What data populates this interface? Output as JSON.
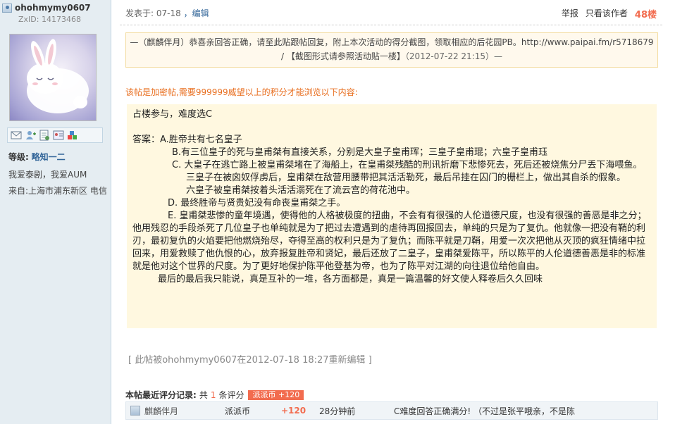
{
  "user": {
    "name": "ohohmymy0607",
    "zxid": "ZxID: 14173468",
    "level_label": "等级:",
    "level_value": "略知一二",
    "signature": "我爱泰剧，我爱AUM",
    "from": "来自:上海市浦东新区 电信"
  },
  "post": {
    "posted_at": "发表于: 07-18",
    "edit_label": "，编辑",
    "report": "举报",
    "only_author": "只看该作者",
    "floor": "48楼"
  },
  "notice": {
    "line1": "—（麒麟伴月）恭喜亲回答正确，请至此贴跟帖回复，附上本次活动的得分截图，领取相应的后花园PB。http://www.paipai.fm/r5718679",
    "line2": "/ 【截图形式请参照活动贴一楼】",
    "line2_date": "（2012-07-22 21:15）—"
  },
  "encrypted_note": "该帖是加密帖,需要999999威望以上的积分才能浏览以下内容:",
  "content": {
    "p1": "占楼参与，难度选C",
    "p2": "答案：A.胜帝共有七名皇子",
    "p3": "B.有三位皇子的死与皇甫桀有直接关系，分别是大皇子皇甫珲；三皇子皇甫琨；六皇子皇甫珏",
    "p4": "C. 大皇子在逃亡路上被皇甫桀堵在了海船上，在皇甫桀残酷的刑讯折磨下悲惨死去，死后还被烧焦分尸丢下海喂鱼。",
    "p5": "三皇子在被囟奴俘虏后，皇甫桀在敌营用腰带把其活活勒死，最后吊挂在囚门的栅栏上，做出其自杀的假象。",
    "p6": "六皇子被皇甫桀按着头活活溺死在了流云宫的荷花池中。",
    "p7": "D. 最终胜帝与贤贵妃没有命丧皇甫桀之手。",
    "p8": "E. 皇甫桀悲惨的童年境遇，使得他的人格被极度的扭曲，不会有有很强的人伦道德尺度，也没有很强的善恶是非之分；他用残忍的手段杀死了几位皇子也单纯就是为了把过去遭遇到的虐待再回报回去，单纯的只是为了复仇。他就像一把没有鞘的利刃，最初复仇的火焰要把他燃烧殆尽，夺得至高的权利只是为了复仇；而陈平就是刀鞘，用爱一次次把他从灭顶的疯狂情绪中拉回来，用爱救赎了他仇恨的心，放弃报复胜帝和贤妃，最后还放了二皇子，皇甫桀爱陈平，所以陈平的人伦道德善恶是非的标准就是他对这个世界的尺度。为了更好地保护陈平他登基为帝，也为了陈平对江湖的向往退位给他自由。",
    "p9": "最后的最后我只能说，真是互补的一堆，各方面都是，真是一篇温馨的好文使人释卷后久久回味"
  },
  "edited_note": "[ 此帖被ohohmymy0607在2012-07-18 18:27重新编辑 ]",
  "rating": {
    "title": "本帖最近评分记录:",
    "count_prefix": "共",
    "count": "1",
    "count_suffix": "条评分",
    "badge": "派派币 +120",
    "rows": [
      {
        "rater": "麒麟伴月",
        "type": "派派币",
        "points": "+120",
        "time": "28分钟前",
        "reason": "C难度回答正确满分! （不过是张平哦亲，不是陈"
      }
    ]
  },
  "colors": {
    "accent_orange": "#f26c4f",
    "link_blue": "#336699",
    "sidebar_bg": "#e5edf2",
    "content_bg": "#fff8e0"
  }
}
